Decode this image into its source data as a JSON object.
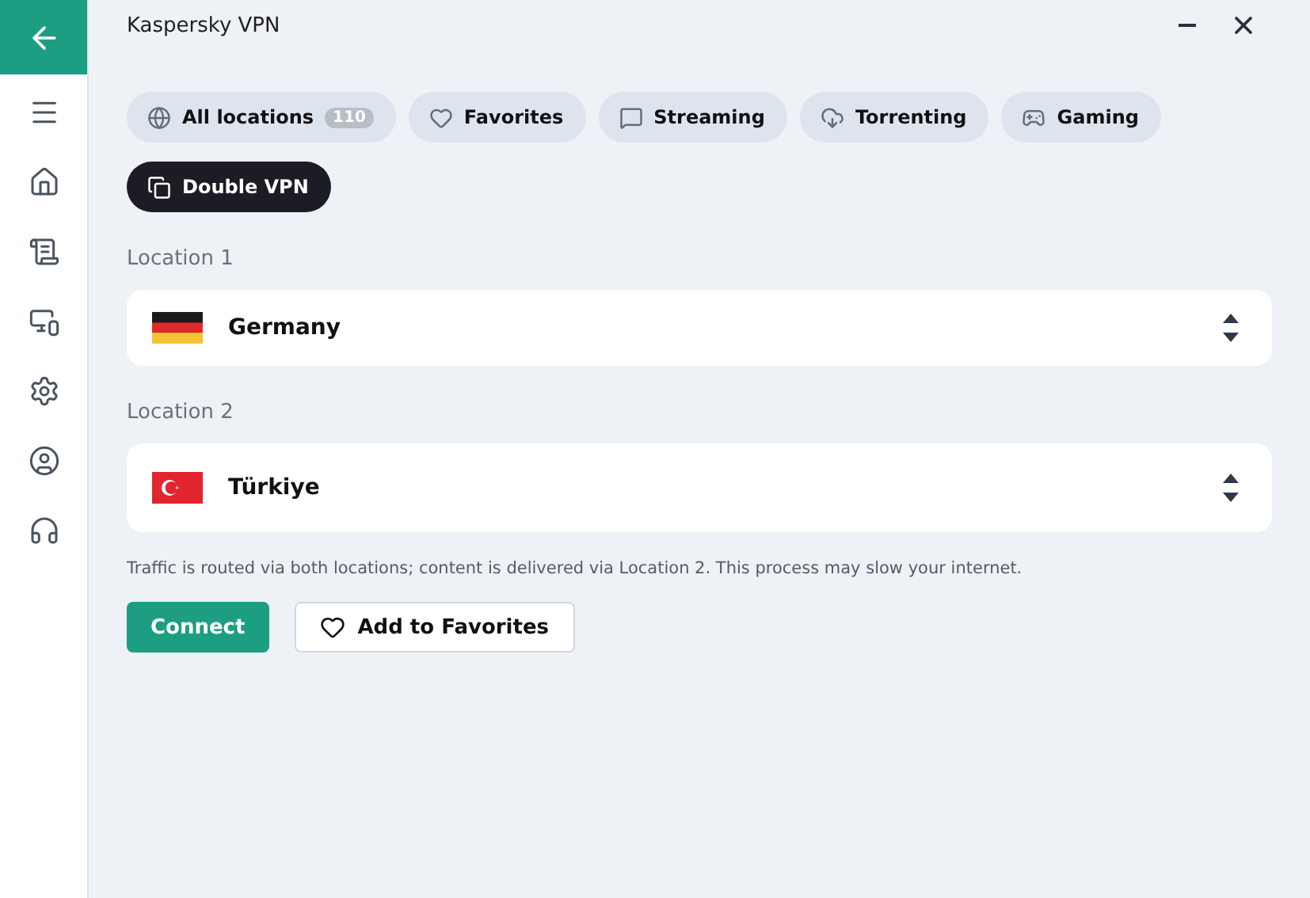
{
  "window": {
    "title": "Kaspersky VPN"
  },
  "filters": [
    {
      "label": "All locations",
      "count": "110",
      "selected": false
    },
    {
      "label": "Favorites",
      "selected": false
    },
    {
      "label": "Streaming",
      "selected": false
    },
    {
      "label": "Torrenting",
      "selected": false
    },
    {
      "label": "Gaming",
      "selected": false
    },
    {
      "label": "Double VPN",
      "selected": true
    }
  ],
  "locations": [
    {
      "label": "Location 1",
      "country": "Germany",
      "kind": "germany"
    },
    {
      "label": "Location 2",
      "country": "Türkiye",
      "kind": "turkey"
    }
  ],
  "note": "Traffic is routed via both locations; content is delivered via Location 2. This process may slow your internet.",
  "buttons": [
    {
      "label": "Connect",
      "kind": "primary"
    },
    {
      "label": "Add to Favorites",
      "kind": "favorite"
    }
  ]
}
